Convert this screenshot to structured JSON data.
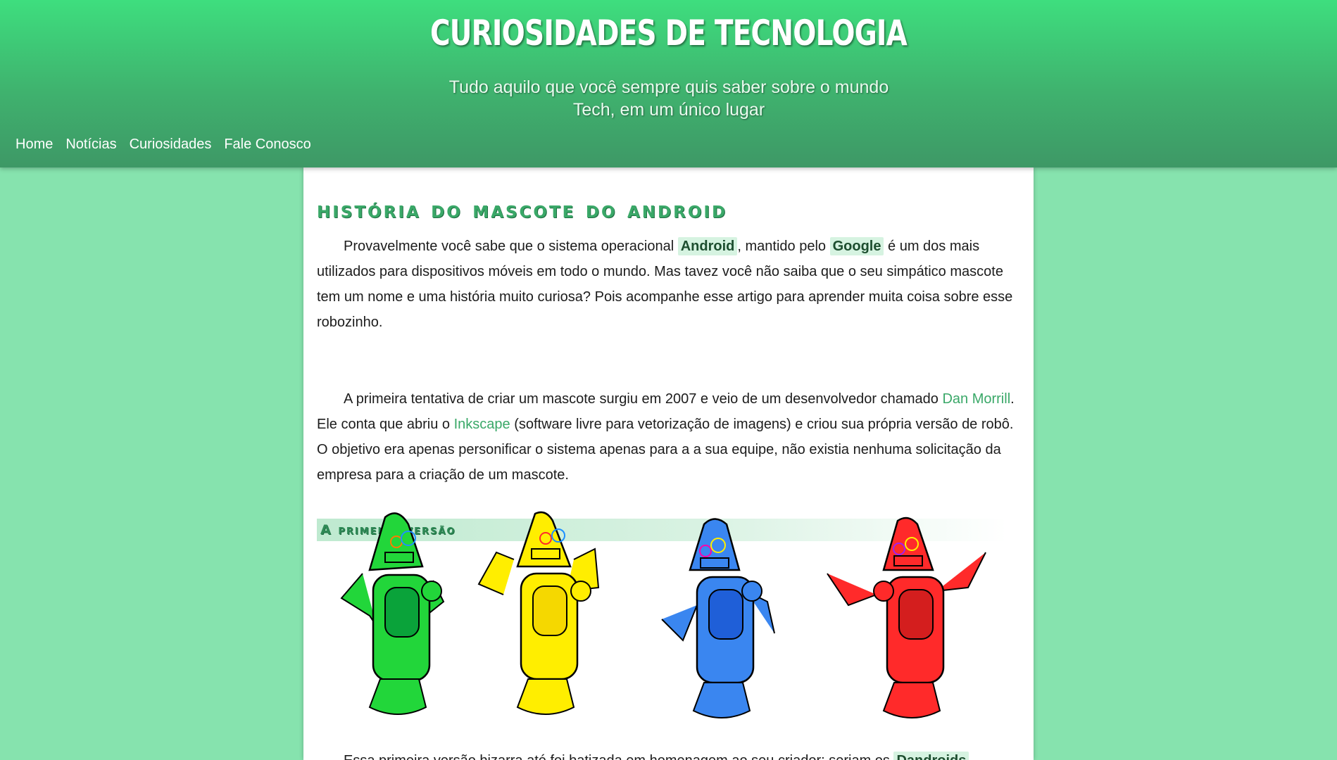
{
  "header": {
    "title": "Curiosidades de Tecnologia",
    "subtitle": "Tudo aquilo que você sempre quis saber sobre o mundo Tech, em um único lugar"
  },
  "nav": {
    "items": [
      "Home",
      "Notícias",
      "Curiosidades",
      "Fale Conosco"
    ]
  },
  "article": {
    "title": "História do mascote do Android",
    "p1": {
      "t1": "Provavelmente você sabe que o sistema operacional ",
      "hl1": "Android",
      "t2": ", mantido pelo ",
      "hl2": "Google",
      "t3": " é um dos mais utilizados para dispositivos móveis em todo o mundo. Mas tavez você não saiba que o seu simpático mascote tem um nome e uma história muito curiosa? Pois acompanhe esse artigo para aprender muita coisa sobre esse robozinho."
    },
    "section1": "A primeira versão",
    "p2": {
      "t1": "A primeira tentativa de criar um mascote surgiu em 2007 e veio de um desenvolvedor chamado ",
      "link1": "Dan Morrill",
      "t2": ". Ele conta que abriu o ",
      "link2": "Inkscape",
      "t3": " (software livre para vetorização de imagens) e criou sua própria versão de robô. O objetivo era apenas personificar o sistema apenas para a a sua equipe, não existia nenhuma solicitação da empresa para a criação de um mascote."
    },
    "p3": {
      "t1": "Essa primeira versão bizarra até foi batizada em homenagem ao seu criador: seriam os ",
      "hl1": "Dandroids"
    },
    "robot_colors": [
      "#22d63a",
      "#ffee00",
      "#3a86f0",
      "#ff2a2a"
    ]
  }
}
